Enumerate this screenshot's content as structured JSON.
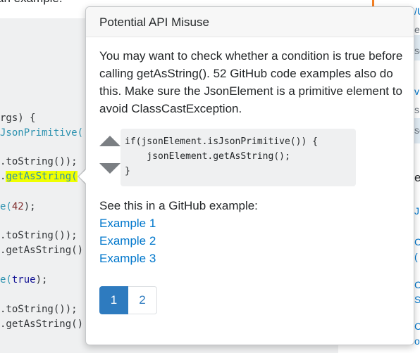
{
  "background": {
    "top_snippet": "an example.",
    "code_lines": [
      {
        "plain": "rgs) {",
        "type": "",
        "num": "",
        "kw": "",
        "hl": ""
      },
      {
        "plain": "",
        "type": "JsonPrimitive(",
        "num": "",
        "kw": "",
        "hl": ""
      },
      {
        "plain": ".toString());",
        "type": "",
        "num": "",
        "kw": "",
        "hl": ""
      },
      {
        "plain": ".",
        "type": "",
        "num": "",
        "kw": "",
        "hl": "getAsString("
      },
      {
        "plain": "",
        "type": "e(",
        "num": "42",
        "kw": "",
        "hl": "",
        "tail": ");"
      },
      {
        "plain": ".toString());",
        "type": "",
        "num": "",
        "kw": "",
        "hl": ""
      },
      {
        "plain": ".getAsString()",
        "type": "",
        "num": "",
        "kw": "",
        "hl": ""
      },
      {
        "plain": "",
        "type": "e(",
        "num": "",
        "kw": "true",
        "hl": "",
        "tail": ");"
      },
      {
        "plain": ".toString());",
        "type": "",
        "num": "",
        "kw": "",
        "hl": ""
      },
      {
        "plain": ".getAsString()",
        "type": "",
        "num": "",
        "kw": "",
        "hl": ""
      }
    ],
    "side_fragments": [
      "/U",
      "e",
      "sc",
      "v",
      "s",
      "sc",
      "e",
      "J",
      "C",
      "(",
      "C",
      "S",
      "C",
      "o"
    ]
  },
  "popup": {
    "title": "Potential API Misuse",
    "message": "You may want to check whether a condition is true before calling getAsString(). 52 GitHub code examples also do this. Make sure the JsonElement is a primitive element to avoid ClassCastException.",
    "code": [
      "if(jsonElement.isJsonPrimitive()) {",
      "    jsonElement.getAsString();",
      "}"
    ],
    "see_label": "See this in a GitHub example:",
    "examples": [
      "Example 1",
      "Example 2",
      "Example 3"
    ],
    "pages": [
      "1",
      "2"
    ]
  },
  "colors": {
    "link": "#0077cc",
    "accent_orange": "#f48024",
    "active_page": "#2e7bbf",
    "highlight": "#f0ff00"
  },
  "icons": [
    "vote-up-icon",
    "vote-down-icon"
  ]
}
